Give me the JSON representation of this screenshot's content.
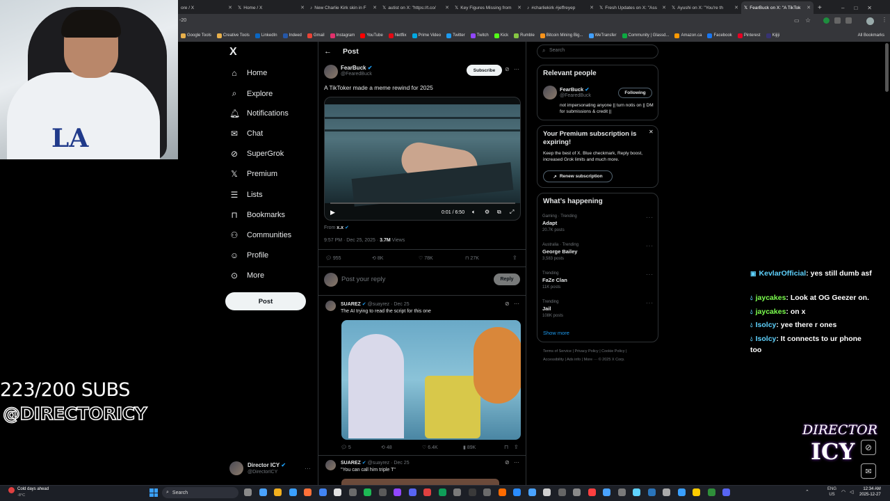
{
  "browser": {
    "tabs": [
      {
        "label": "ore / X",
        "active": false
      },
      {
        "label": "Home / X",
        "active": false
      },
      {
        "label": "New Charlie Kirk skin in F",
        "active": false
      },
      {
        "label": "autist on X: \"https://t.co/",
        "active": false
      },
      {
        "label": "Key Figures Missing from",
        "active": false
      },
      {
        "label": "#charliekirk #jeffreyep",
        "active": false
      },
      {
        "label": "Fresh Updates on X: \"Ass",
        "active": false
      },
      {
        "label": "Ayushi on X: \"You're th",
        "active": false
      },
      {
        "label": "FearBuck on X: \"A TikTok",
        "active": true
      }
    ],
    "new_tab": "+",
    "address_fragment": "-20",
    "bookmarks": [
      {
        "label": "Google Tools",
        "color": "#e8b04b"
      },
      {
        "label": "Creative Tools",
        "color": "#e8b04b"
      },
      {
        "label": "LinkedIn",
        "color": "#0a66c2"
      },
      {
        "label": "Indeed",
        "color": "#2557a7"
      },
      {
        "label": "Gmail",
        "color": "#ea4335"
      },
      {
        "label": "Instagram",
        "color": "#e1306c"
      },
      {
        "label": "YouTube",
        "color": "#ff0000"
      },
      {
        "label": "Netflix",
        "color": "#e50914"
      },
      {
        "label": "Prime Video",
        "color": "#00a8e1"
      },
      {
        "label": "Twitter",
        "color": "#1d9bf0"
      },
      {
        "label": "Twitch",
        "color": "#9146ff"
      },
      {
        "label": "Kick",
        "color": "#53fc18"
      },
      {
        "label": "Rumble",
        "color": "#85c742"
      },
      {
        "label": "Bitcoin Mining Big...",
        "color": "#f7931a"
      },
      {
        "label": "WeTransfer",
        "color": "#409fff"
      },
      {
        "label": "Community | Glassd...",
        "color": "#0caa41"
      },
      {
        "label": "Amazon.ca",
        "color": "#ff9900"
      },
      {
        "label": "Facebook",
        "color": "#1877f2"
      },
      {
        "label": "Pinterest",
        "color": "#e60023"
      },
      {
        "label": "Kijiji",
        "color": "#373373"
      }
    ],
    "all_bookmarks": "All Bookmarks"
  },
  "sidebar": {
    "logo": "X",
    "items": [
      {
        "label": "Home",
        "icon": "home-icon"
      },
      {
        "label": "Explore",
        "icon": "search-icon"
      },
      {
        "label": "Notifications",
        "icon": "bell-icon"
      },
      {
        "label": "Chat",
        "icon": "mail-icon"
      },
      {
        "label": "SuperGrok",
        "icon": "grok-icon"
      },
      {
        "label": "Premium",
        "icon": "x-icon"
      },
      {
        "label": "Lists",
        "icon": "list-icon"
      },
      {
        "label": "Bookmarks",
        "icon": "bookmark-icon"
      },
      {
        "label": "Communities",
        "icon": "people-icon"
      },
      {
        "label": "Profile",
        "icon": "person-icon"
      },
      {
        "label": "More",
        "icon": "more-circle-icon"
      }
    ],
    "post_button": "Post",
    "account": {
      "name": "Director ICY",
      "handle": "@DirectorICY"
    }
  },
  "main": {
    "header": "Post",
    "tweet": {
      "author": "FearBuck",
      "handle": "@FearedBuck",
      "subscribe": "Subscribe",
      "text": "A TikToker made a meme rewind for 2025",
      "video_time": "0:01 / 6:50",
      "from_label": "From",
      "from_account": "x.x",
      "timestamp": "9:57 PM · Dec 25, 2025 · ",
      "views_count": "3.7M",
      "views_label": " Views",
      "stats": {
        "replies": "955",
        "reposts": "8K",
        "likes": "78K",
        "bookmarks": "27K"
      }
    },
    "reply_box": {
      "placeholder": "Post your reply",
      "button": "Reply"
    },
    "replies": [
      {
        "author": "SUAREZ",
        "handle": "@suayrez",
        "date": "· Dec 25",
        "text": "The AI trying to read the script for this one",
        "stats": {
          "replies": "5",
          "reposts": "48",
          "likes": "6.4K",
          "views": "89K"
        }
      },
      {
        "author": "SUAREZ",
        "handle": "@suayrez",
        "date": "· Dec 25",
        "text": "\"You can call him triple T\""
      }
    ]
  },
  "right": {
    "search_placeholder": "Search",
    "relevant": {
      "title": "Relevant people",
      "name": "FearBuck",
      "handle": "@FearedBuck",
      "button": "Following",
      "bio": "not impersonating anyone || turn notis on || DM for submissions & credit ||"
    },
    "premium": {
      "title": "Your Premium subscription is expiring!",
      "body": "Keep the best of X. Blue checkmark, Reply boost, increased Grok limits and much more.",
      "button": "Renew subscription"
    },
    "happening": {
      "title": "What’s happening",
      "trends": [
        {
          "context": "Gaming · Trending",
          "name": "Adapt",
          "posts": "20.7K posts"
        },
        {
          "context": "Australia · Trending",
          "name": "George Bailey",
          "posts": "3,583 posts"
        },
        {
          "context": "Trending",
          "name": "FaZe Clan",
          "posts": "11K posts"
        },
        {
          "context": "Trending",
          "name": "Jail",
          "posts": "108K posts"
        }
      ],
      "show_more": "Show more"
    },
    "footer": {
      "line1": "Terms of Service  |  Privacy Policy  |  Cookie Policy  |",
      "line2": "Accessibility  |  Ads info  |  More ···  © 2025 X Corp."
    }
  },
  "overlay": {
    "subs": "223/200 SUBS",
    "handle": "@DIRECTORICY",
    "chat": [
      {
        "user": "KevlarOfficial",
        "color": "#5fd3ff",
        "text": ": yes still dumb asf"
      },
      {
        "user": "jaycakes",
        "color": "#7cff4f",
        "text": ": Look at OG Geezer on."
      },
      {
        "user": "jaycakes",
        "color": "#7cff4f",
        "text": ": on x"
      },
      {
        "user": "Isolcy",
        "color": "#5fd3ff",
        "text": ": yee there r ones"
      },
      {
        "user": "Isolcy",
        "color": "#5fd3ff",
        "text": ": It connects to ur phone too"
      }
    ],
    "brand_top": "DIRECTOR",
    "brand_bottom": "ICY"
  },
  "taskbar": {
    "weather_title": "Cold days ahead",
    "weather_temp": "-8°C",
    "search": "Search",
    "lang1": "ENG",
    "lang2": "US",
    "time": "12:34 AM",
    "date": "2025-12-27"
  }
}
